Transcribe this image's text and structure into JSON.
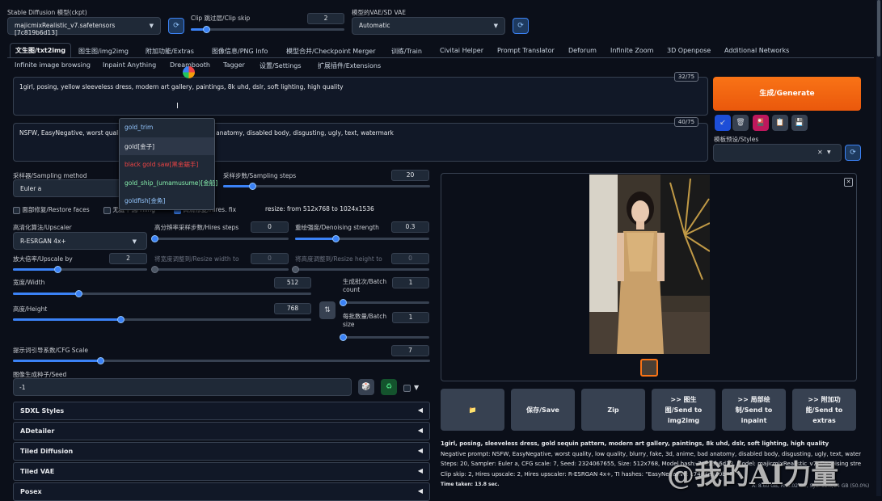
{
  "top": {
    "model_label": "Stable Diffusion 模型(ckpt)",
    "model_value": "majicmixRealistic_v7.safetensors [7c819b6d13]",
    "clip_label": "Clip 跳过层/Clip skip",
    "clip_value": "2",
    "clip_fraction": 0.1,
    "vae_label": "模型的VAE/SD VAE",
    "vae_value": "Automatic"
  },
  "tabs_row1": [
    "文生图/txt2img",
    "图生图/img2img",
    "附加功能/Extras",
    "图像信息/PNG Info",
    "模型合并/Checkpoint Merger",
    "训练/Train",
    "Civitai Helper",
    "Prompt Translator",
    "Deforum",
    "Infinite Zoom",
    "3D Openpose",
    "Additional Networks"
  ],
  "tabs_row2": [
    "Infinite image browsing",
    "Inpaint Anything",
    "Dreambooth",
    "Tagger",
    "设置/Settings",
    "扩展插件/Extensions"
  ],
  "prompt": {
    "text": "1girl, posing, yellow sleeveless dress, modern art gallery, paintings, 8k uhd, dslr, soft lighting, high quality",
    "counter": "32/75"
  },
  "negative": {
    "text_start": "NSFW, EasyNegative, worst quality, lo",
    "text_end": "d anatomy, disabled body, disgusting, ugly, text, watermark",
    "counter": "40/75"
  },
  "autocomplete": [
    {
      "text": "gold_trim",
      "color": "#93c5fd"
    },
    {
      "text": "gold[金子]",
      "color": "#e5e7eb"
    },
    {
      "text": "black gold saw[黑金鋸手]",
      "color": "#ef4444"
    },
    {
      "text": "gold_ship_(umamusume)[金船]",
      "color": "#86efac"
    },
    {
      "text": "goldfish[金魚]",
      "color": "#93c5fd"
    }
  ],
  "generate": {
    "label": "生成/Generate",
    "styles_label": "模板预设/Styles"
  },
  "sampler": {
    "label": "采样器/Sampling method",
    "value": "Euler a",
    "steps_label": "采样步数/Sampling steps",
    "steps_value": "20",
    "steps_fraction": 0.14
  },
  "checkboxes": {
    "restore_faces": "面部修复/Restore faces",
    "tiling": "无缝平铺/Tiling",
    "hires": "高清修复/Hires. fix",
    "resize_info": "resize: from 512x768 to 1024x1536"
  },
  "hires": {
    "upscaler_label": "高清化算法/Upscaler",
    "upscaler_value": "R-ESRGAN 4x+",
    "steps_label": "高分辨率采样步数/Hires steps",
    "steps_value": "0",
    "steps_fraction": 0.0,
    "denoise_label": "重绘强度/Denoising strength",
    "denoise_value": "0.3",
    "denoise_fraction": 0.3,
    "upscale_label": "放大倍率/Upscale by",
    "upscale_value": "2",
    "upscale_fraction": 0.33,
    "resize_w_label": "将宽度调整到/Resize width to",
    "resize_w_value": "0",
    "resize_h_label": "将高度调整到/Resize height to",
    "resize_h_value": "0"
  },
  "dims": {
    "width_label": "宽度/Width",
    "width_value": "512",
    "width_fraction": 0.22,
    "height_label": "高度/Height",
    "height_value": "768",
    "height_fraction": 0.36,
    "batch_count_label": "生成批次/Batch count",
    "batch_count_value": "1",
    "batch_count_fraction": 0.0,
    "batch_size_label": "每批数量/Batch size",
    "batch_size_value": "1",
    "batch_size_fraction": 0.0
  },
  "cfg": {
    "label": "提示词引导系数/CFG Scale",
    "value": "7",
    "fraction": 0.21
  },
  "seed": {
    "label": "图像生成种子/Seed",
    "value": "-1"
  },
  "accordions": [
    "SDXL Styles",
    "ADetailer",
    "Tiled Diffusion",
    "Tiled VAE",
    "Posex"
  ],
  "output_buttons": [
    {
      "l1": "📁",
      "l2": "",
      "l3": ""
    },
    {
      "l1": "保存/Save",
      "l2": "",
      "l3": ""
    },
    {
      "l1": "Zip",
      "l2": "",
      "l3": ""
    },
    {
      "l1": ">> 图生",
      "l2": "图/Send to",
      "l3": "img2img"
    },
    {
      "l1": ">> 局部绘",
      "l2": "制/Send to",
      "l3": "inpaint"
    },
    {
      "l1": ">> 附加功",
      "l2": "能/Send to",
      "l3": "extras"
    }
  ],
  "info": {
    "line1": "1girl, posing, sleeveless dress, gold sequin pattern, modern art gallery, paintings, 8k uhd, dslr, soft lighting, high quality",
    "line2": "Negative prompt: NSFW, EasyNegative, worst quality, low quality, blurry, fake, 3d, anime, bad anatomy, disabled body, disgusting, ugly, text, watermark",
    "line3": "Steps: 20, Sampler: Euler a, CFG scale: 7, Seed: 2324067655, Size: 512x768, Model hash: 7c819b6d13, Model: majicmixRealistic_v7, Denoising strength: 0.3,",
    "line4": "Clip skip: 2, Hires upscale: 2, Hires upscaler: R-ESRGAN 4x+, TI hashes: \"EasyNegative: c74b4e810b03\"",
    "time": "Time taken: 13.8 sec.",
    "vram": "A: 8.60 GB, R: 9.02 GB, Sys: 12.0/24 GB (50.0%)"
  },
  "watermark": "@我的AI力量"
}
